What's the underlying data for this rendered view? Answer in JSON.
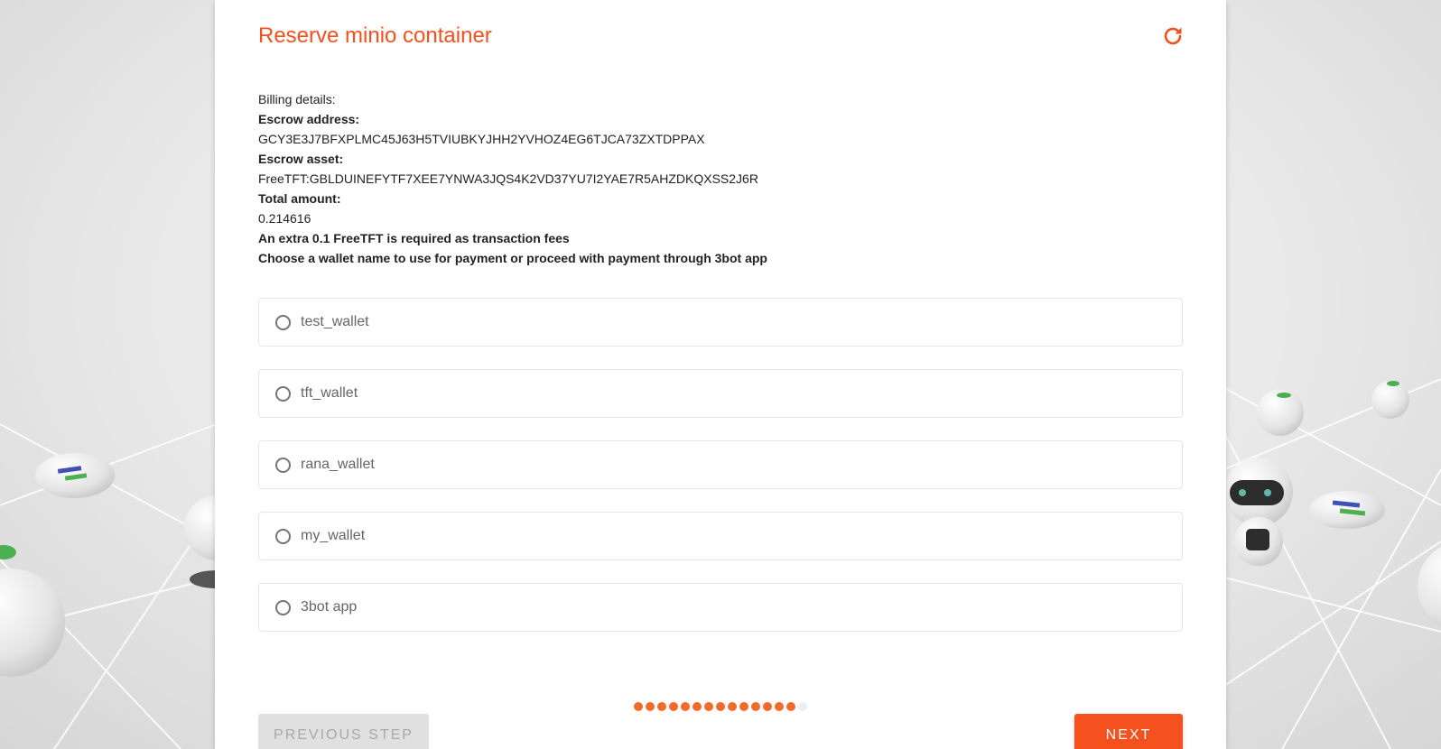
{
  "form": {
    "title": "Reserve minio container",
    "refresh_icon": "refresh-icon",
    "billing": {
      "heading": "Billing details:",
      "escrow_address_label": "Escrow address:",
      "escrow_address": "GCY3E3J7BFXPLMC45J63H5TVIUBKYJHH2YVHOZ4EG6TJCA73ZXTDPPAX",
      "escrow_asset_label": "Escrow asset:",
      "escrow_asset": "FreeTFT:GBLDUINEFYTF7XEE7YNWA3JQS4K2VD37YU7I2YAE7R5AHZDKQXSS2J6R",
      "total_amount_label": "Total amount:",
      "total_amount": "0.214616",
      "fees_note": "An extra 0.1 FreeTFT is required as transaction fees",
      "choose_note": "Choose a wallet name to use for payment or proceed with payment through 3bot app"
    },
    "wallet_options": [
      {
        "label": "test_wallet",
        "selected": false
      },
      {
        "label": "tft_wallet",
        "selected": false
      },
      {
        "label": "rana_wallet",
        "selected": false
      },
      {
        "label": "my_wallet",
        "selected": false
      },
      {
        "label": "3bot app",
        "selected": false
      }
    ],
    "progress": {
      "total_steps": 15,
      "completed_steps": 14
    },
    "prev_button": "PREVIOUS STEP",
    "next_button": "NEXT"
  },
  "colors": {
    "accent": "#f4511e",
    "dot_active": "#f46a2a",
    "dot_inactive": "#eeeeee",
    "prev_bg": "#e0e0e0"
  }
}
